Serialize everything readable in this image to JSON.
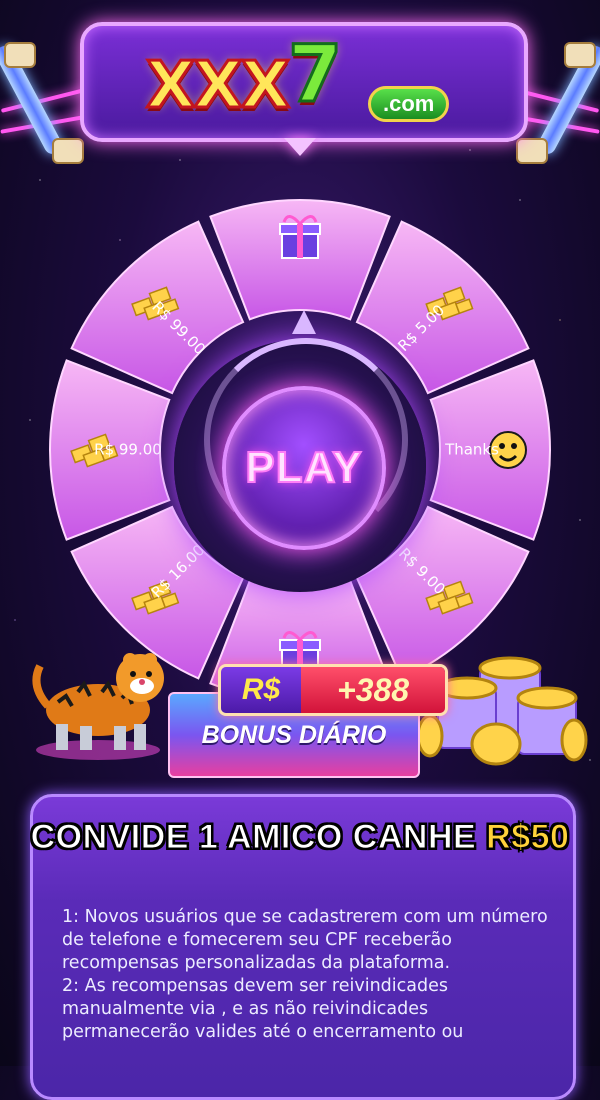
{
  "header": {
    "logo_main": "XXX",
    "logo_seven": "7",
    "logo_suffix": ".com"
  },
  "wheel": {
    "segments": [
      {
        "label": "",
        "icon": "gift-box-icon"
      },
      {
        "label": "R$ 5.00",
        "icon": "gold-bars-icon"
      },
      {
        "label": "Thanks",
        "icon": "smiley-face-icon"
      },
      {
        "label": "R$ 9.00",
        "icon": "gold-bars-icon"
      },
      {
        "label": "",
        "icon": "gift-box-icon"
      },
      {
        "label": "R$ 16.00",
        "icon": "gold-bars-icon"
      },
      {
        "label": "R$ 99.00",
        "icon": "gold-bars-icon"
      },
      {
        "label": "R$ 99.00",
        "icon": "gold-bars-icon"
      }
    ],
    "play_label": "PLAY"
  },
  "bonus": {
    "currency": "R$",
    "amount": "+388",
    "button_label": "BONUS DIÁRIO"
  },
  "invite": {
    "title_text": "CONVIDE 1 AMICO CANHE ",
    "title_highlight": "R$50",
    "rules": [
      "1: Novos usuários que se cadastrerem com um número de telefone e fomecerem seu CPF receberão recompensas personalizadas da plataforma.",
      "2: As recompensas devem ser reivindicades manualmente via , e as não reivindicades permanecerão valides até o encerramento ou"
    ]
  },
  "colors": {
    "accent_pink": "#ff57f0",
    "gold": "#ffd23a",
    "purple": "#7a2fd6"
  }
}
